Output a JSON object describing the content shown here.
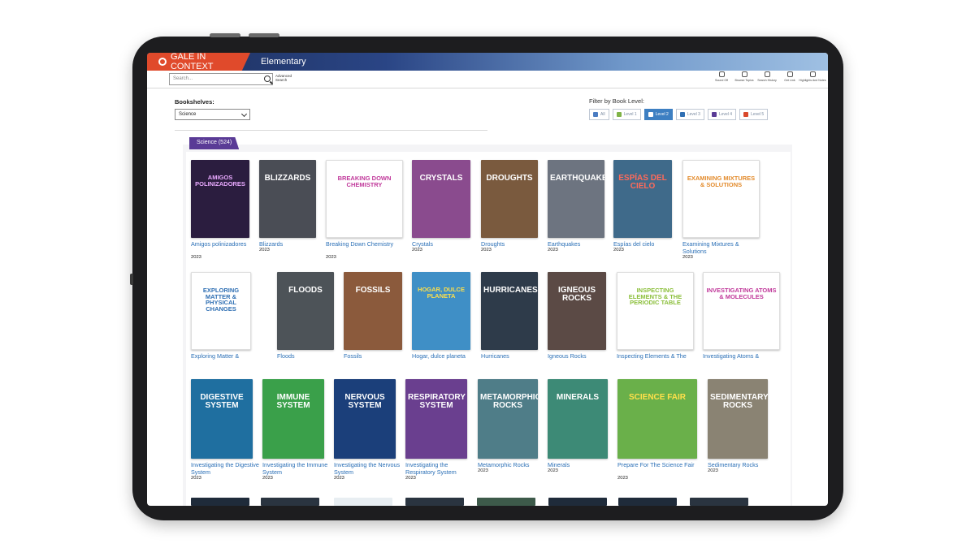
{
  "header": {
    "brand": "GALE IN CONTEXT",
    "edition": "Elementary"
  },
  "toolbar": {
    "search_placeholder": "Search...",
    "advanced_search": "Advanced Search",
    "tools": [
      {
        "label": "Sound Off",
        "icon": "speaker-icon"
      },
      {
        "label": "Browse Topics",
        "icon": "lightbulb-icon"
      },
      {
        "label": "Search History",
        "icon": "history-icon"
      },
      {
        "label": "Get Link",
        "icon": "link-icon"
      },
      {
        "label": "Highlights And Notes",
        "icon": "pencil-icon"
      }
    ]
  },
  "bookshelves": {
    "label": "Bookshelves:",
    "selected": "Science"
  },
  "filter": {
    "label": "Filter by Book Level:",
    "levels": [
      {
        "label": "All",
        "color": "#4a7cc2",
        "active": false
      },
      {
        "label": "Level 1",
        "color": "#7fb347",
        "active": false
      },
      {
        "label": "Level 2",
        "color": "#2f6fb3",
        "active": true
      },
      {
        "label": "Level 3",
        "color": "#2f6fb3",
        "active": false
      },
      {
        "label": "Level 4",
        "color": "#5a3b96",
        "active": false
      },
      {
        "label": "Level 5",
        "color": "#d9482b",
        "active": false
      }
    ]
  },
  "shelf": {
    "tab_label": "Science (524)"
  },
  "books": [
    {
      "title": "Amigos polinizadores",
      "year": "2023",
      "cover_text": "AMIGOS POLINIZADORES",
      "bg": "#2b1d3f",
      "fg": "#e9a9ff"
    },
    {
      "title": "Blizzards",
      "year": "2023",
      "cover_text": "BLIZZARDS",
      "bg": "#4a4d55",
      "fg": "#ffffff"
    },
    {
      "title": "Breaking Down Chemistry",
      "year": "2023",
      "cover_text": "BREAKING DOWN CHEMISTRY",
      "bg": "#ffffff",
      "fg": "#c0389a"
    },
    {
      "title": "Crystals",
      "year": "2023",
      "cover_text": "CRYSTALS",
      "bg": "#8a4b8e",
      "fg": "#ffffff"
    },
    {
      "title": "Droughts",
      "year": "2023",
      "cover_text": "DROUGHTS",
      "bg": "#7a5a3e",
      "fg": "#ffffff"
    },
    {
      "title": "Earthquakes",
      "year": "2023",
      "cover_text": "EARTHQUAKES",
      "bg": "#6d7480",
      "fg": "#ffffff"
    },
    {
      "title": "Espías del cielo",
      "year": "2023",
      "cover_text": "ESPÍAS DEL CIELO",
      "bg": "#3f6a8a",
      "fg": "#ff6a5a"
    },
    {
      "title": "Examining Mixtures & Solutions",
      "year": "2023",
      "cover_text": "EXAMINING MIXTURES & SOLUTIONS",
      "bg": "#ffffff",
      "fg": "#e38b2c"
    },
    {
      "title": "Exploring Matter &",
      "year": "",
      "cover_text": "EXPLORING MATTER & PHYSICAL CHANGES",
      "bg": "#ffffff",
      "fg": "#2f6fb3"
    },
    {
      "title": "Floods",
      "year": "",
      "cover_text": "FLOODS",
      "bg": "#4d5358",
      "fg": "#ffffff"
    },
    {
      "title": "Fossils",
      "year": "",
      "cover_text": "FOSSILS",
      "bg": "#8b5a3c",
      "fg": "#ffffff"
    },
    {
      "title": "Hogar, dulce planeta",
      "year": "",
      "cover_text": "HOGAR, DULCE PLANETA",
      "bg": "#3f8fc6",
      "fg": "#ffe04a"
    },
    {
      "title": "Hurricanes",
      "year": "",
      "cover_text": "HURRICANES",
      "bg": "#2e3b4a",
      "fg": "#ffffff"
    },
    {
      "title": "Igneous Rocks",
      "year": "",
      "cover_text": "IGNEOUS ROCKS",
      "bg": "#5b4a45",
      "fg": "#ffffff"
    },
    {
      "title": "Inspecting Elements & The",
      "year": "",
      "cover_text": "INSPECTING ELEMENTS & THE PERIODIC TABLE",
      "bg": "#ffffff",
      "fg": "#8bbf3a"
    },
    {
      "title": "Investigating Atoms &",
      "year": "",
      "cover_text": "INVESTIGATING ATOMS & MOLECULES",
      "bg": "#ffffff",
      "fg": "#c0389a"
    },
    {
      "title": "Investigating the Digestive System",
      "year": "2023",
      "cover_text": "DIGESTIVE SYSTEM",
      "bg": "#1f6fa0",
      "fg": "#ffffff"
    },
    {
      "title": "Investigating the Immune System",
      "year": "2023",
      "cover_text": "IMMUNE SYSTEM",
      "bg": "#3aa04a",
      "fg": "#ffffff"
    },
    {
      "title": "Investigating the Nervous System",
      "year": "2023",
      "cover_text": "NERVOUS SYSTEM",
      "bg": "#1b3f7a",
      "fg": "#ffffff"
    },
    {
      "title": "Investigating the Respiratory System",
      "year": "2023",
      "cover_text": "RESPIRATORY SYSTEM",
      "bg": "#6a3f8f",
      "fg": "#ffffff"
    },
    {
      "title": "Metamorphic Rocks",
      "year": "2023",
      "cover_text": "METAMORPHIC ROCKS",
      "bg": "#4f7d88",
      "fg": "#ffffff"
    },
    {
      "title": "Minerals",
      "year": "2023",
      "cover_text": "MINERALS",
      "bg": "#3d8a76",
      "fg": "#ffffff"
    },
    {
      "title": "Prepare For The Science Fair",
      "year": "2023",
      "cover_text": "SCIENCE FAIR",
      "bg": "#6ab04a",
      "fg": "#ffe04a"
    },
    {
      "title": "Sedimentary Rocks",
      "year": "2023",
      "cover_text": "SEDIMENTARY ROCKS",
      "bg": "#8a8373",
      "fg": "#ffffff"
    }
  ]
}
